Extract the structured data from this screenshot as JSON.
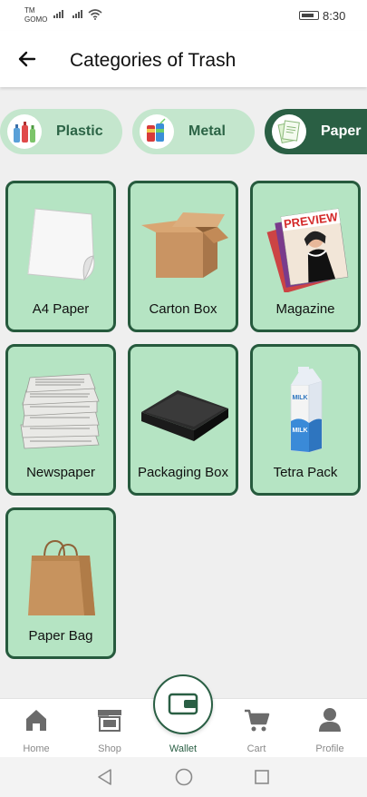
{
  "status_bar": {
    "carrier_line1": "TM",
    "carrier_line2": "GOMO",
    "time": "8:30"
  },
  "header": {
    "title": "Categories of Trash",
    "back_icon": "arrow-left-icon"
  },
  "tabs": [
    {
      "label": "Plastic",
      "icon": "plastic-bottles-icon",
      "active": false
    },
    {
      "label": "Metal",
      "icon": "metal-cans-icon",
      "active": false
    },
    {
      "label": "Paper",
      "icon": "paper-sheets-icon",
      "active": true
    }
  ],
  "items": [
    {
      "label": "A4 Paper",
      "icon": "a4-paper-image"
    },
    {
      "label": "Carton Box",
      "icon": "carton-box-image"
    },
    {
      "label": "Magazine",
      "icon": "magazine-image",
      "cover_text": "PREVIEW"
    },
    {
      "label": "Newspaper",
      "icon": "newspaper-image"
    },
    {
      "label": "Packaging Box",
      "icon": "packaging-box-image"
    },
    {
      "label": "Tetra Pack",
      "icon": "tetra-pack-image",
      "carton_text": "MILK"
    },
    {
      "label": "Paper Bag",
      "icon": "paper-bag-image"
    }
  ],
  "bottom_nav": [
    {
      "label": "Home",
      "icon": "home-icon",
      "active": false
    },
    {
      "label": "Shop",
      "icon": "shop-icon",
      "active": false
    },
    {
      "label": "Wallet",
      "icon": "wallet-icon",
      "active": true
    },
    {
      "label": "Cart",
      "icon": "cart-icon",
      "active": false
    },
    {
      "label": "Profile",
      "icon": "profile-icon",
      "active": false
    }
  ],
  "colors": {
    "accent": "#2a5f44",
    "card_fill": "#b5e4c3",
    "tab_fill": "#c4e6cd",
    "background": "#efefef"
  }
}
